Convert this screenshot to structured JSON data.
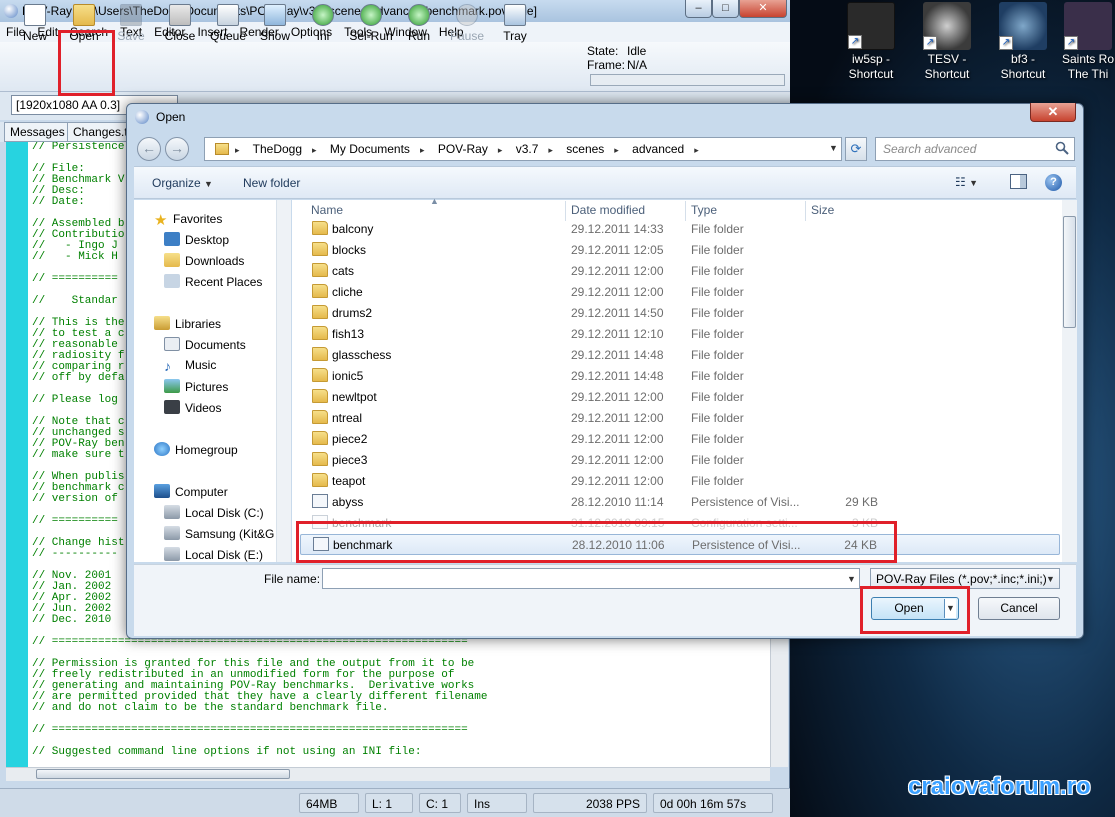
{
  "window": {
    "title": "POV-Ray - C:\\Users\\TheDogg\\Documents\\POV-Ray\\v3.7\\scenes\\advanced\\benchmark.pov [Idle]"
  },
  "menu": [
    "File",
    "Edit",
    "Search",
    "Text",
    "Editor",
    "Insert",
    "Render",
    "Options",
    "Tools",
    "Window",
    "Help"
  ],
  "toolbar": {
    "buttons": [
      {
        "label": "New"
      },
      {
        "label": "Open"
      },
      {
        "label": "Save"
      },
      {
        "label": "Close"
      },
      {
        "label": "Queue"
      },
      {
        "label": "Show"
      },
      {
        "label": "Ini"
      },
      {
        "label": "Sel-Run"
      },
      {
        "label": "Run"
      },
      {
        "label": "Pause"
      },
      {
        "label": "Tray"
      }
    ]
  },
  "render_status": {
    "state_label": "State:",
    "state": "Idle",
    "frame_label": "Frame:",
    "frame": "N/A"
  },
  "resolution_select": "[1920x1080 AA 0.3]",
  "tabs": [
    "Messages",
    "Changes.t"
  ],
  "code_lines": [
    "// Persistence",
    "",
    "// File:",
    "// Benchmark V",
    "// Desc:",
    "// Date:",
    "",
    "// Assembled b",
    "// Contributio",
    "//   - Ingo J",
    "//   - Mick H",
    "",
    "// ==========",
    "",
    "//    Standar",
    "",
    "// This is the",
    "// to test a c",
    "// reasonable",
    "// radiosity f",
    "// comparing r",
    "// off by defa",
    "",
    "// Please log",
    "",
    "// Note that c",
    "// unchanged s",
    "// POV-Ray ben",
    "// make sure t",
    "",
    "// When publis",
    "// benchmark c",
    "// version of",
    "",
    "// ==========",
    "",
    "// Change hist",
    "// ----------",
    "",
    "// Nov. 2001",
    "// Jan. 2002",
    "// Apr. 2002",
    "// Jun. 2002",
    "// Dec. 2010",
    "",
    "// ===============================================================",
    "",
    "// Permission is granted for this file and the output from it to be",
    "// freely redistributed in an unmodified form for the purpose of",
    "// generating and maintaining POV-Ray benchmarks.  Derivative works",
    "// are permitted provided that they have a clearly different filename",
    "// and do not claim to be the standard benchmark file.",
    "",
    "// ===============================================================",
    "",
    "// Suggested command line options if not using an INI file:"
  ],
  "statusbar": {
    "memory": "64MB",
    "line": "L: 1",
    "col": "C: 1",
    "mode": "Ins",
    "pps": "2038 PPS",
    "time": "0d 00h 16m 57s"
  },
  "desktop": {
    "icons": [
      {
        "label1": "iw5sp -",
        "label2": "Shortcut",
        "color": "#2a2a2a"
      },
      {
        "label1": "TESV -",
        "label2": "Shortcut",
        "color": "#3b3b3b"
      },
      {
        "label1": "bf3 -",
        "label2": "Shortcut",
        "color": "#1f3e63"
      },
      {
        "label1": "Saints Ro",
        "label2": "The Thi",
        "color": "#3a2f4a"
      }
    ],
    "watermark": "craiovaforum.ro"
  },
  "dialog": {
    "title": "Open",
    "address": [
      "TheDogg",
      "My Documents",
      "POV-Ray",
      "v3.7",
      "scenes",
      "advanced"
    ],
    "search_placeholder": "Search advanced",
    "organize": "Organize",
    "new_folder": "New folder",
    "nav": {
      "favorites": "Favorites",
      "desktop": "Desktop",
      "downloads": "Downloads",
      "recent": "Recent Places",
      "libraries": "Libraries",
      "documents": "Documents",
      "music": "Music",
      "pictures": "Pictures",
      "videos": "Videos",
      "homegroup": "Homegroup",
      "computer": "Computer",
      "local_c": "Local Disk (C:)",
      "samsung": "Samsung (Kit&G",
      "local_e": "Local Disk (E:)"
    },
    "columns": {
      "name": "Name",
      "date": "Date modified",
      "type": "Type",
      "size": "Size"
    },
    "files": [
      {
        "name": "balcony",
        "date": "29.12.2011 14:33",
        "type": "File folder",
        "size": "",
        "kind": "folder"
      },
      {
        "name": "blocks",
        "date": "29.12.2011 12:05",
        "type": "File folder",
        "size": "",
        "kind": "folder"
      },
      {
        "name": "cats",
        "date": "29.12.2011 12:00",
        "type": "File folder",
        "size": "",
        "kind": "folder"
      },
      {
        "name": "cliche",
        "date": "29.12.2011 12:00",
        "type": "File folder",
        "size": "",
        "kind": "folder"
      },
      {
        "name": "drums2",
        "date": "29.12.2011 14:50",
        "type": "File folder",
        "size": "",
        "kind": "folder"
      },
      {
        "name": "fish13",
        "date": "29.12.2011 12:10",
        "type": "File folder",
        "size": "",
        "kind": "folder"
      },
      {
        "name": "glasschess",
        "date": "29.12.2011 14:48",
        "type": "File folder",
        "size": "",
        "kind": "folder"
      },
      {
        "name": "ionic5",
        "date": "29.12.2011 14:48",
        "type": "File folder",
        "size": "",
        "kind": "folder"
      },
      {
        "name": "newltpot",
        "date": "29.12.2011 12:00",
        "type": "File folder",
        "size": "",
        "kind": "folder"
      },
      {
        "name": "ntreal",
        "date": "29.12.2011 12:00",
        "type": "File folder",
        "size": "",
        "kind": "folder"
      },
      {
        "name": "piece2",
        "date": "29.12.2011 12:00",
        "type": "File folder",
        "size": "",
        "kind": "folder"
      },
      {
        "name": "piece3",
        "date": "29.12.2011 12:00",
        "type": "File folder",
        "size": "",
        "kind": "folder"
      },
      {
        "name": "teapot",
        "date": "29.12.2011 12:00",
        "type": "File folder",
        "size": "",
        "kind": "folder"
      },
      {
        "name": "abyss",
        "date": "28.12.2010 11:14",
        "type": "Persistence of Visi...",
        "size": "29 KB",
        "kind": "pov"
      },
      {
        "name": "benchmark",
        "date": "31.12.2010 09:15",
        "type": "Configuration setti...",
        "size": "3 KB",
        "kind": "ini"
      },
      {
        "name": "benchmark",
        "date": "28.12.2010 11:06",
        "type": "Persistence of Visi...",
        "size": "24 KB",
        "kind": "pov"
      }
    ],
    "file_name_label": "File name:",
    "file_name_value": "",
    "file_type": "POV-Ray Files (*.pov;*.inc;*.ini;)",
    "open_label": "Open",
    "cancel_label": "Cancel"
  }
}
